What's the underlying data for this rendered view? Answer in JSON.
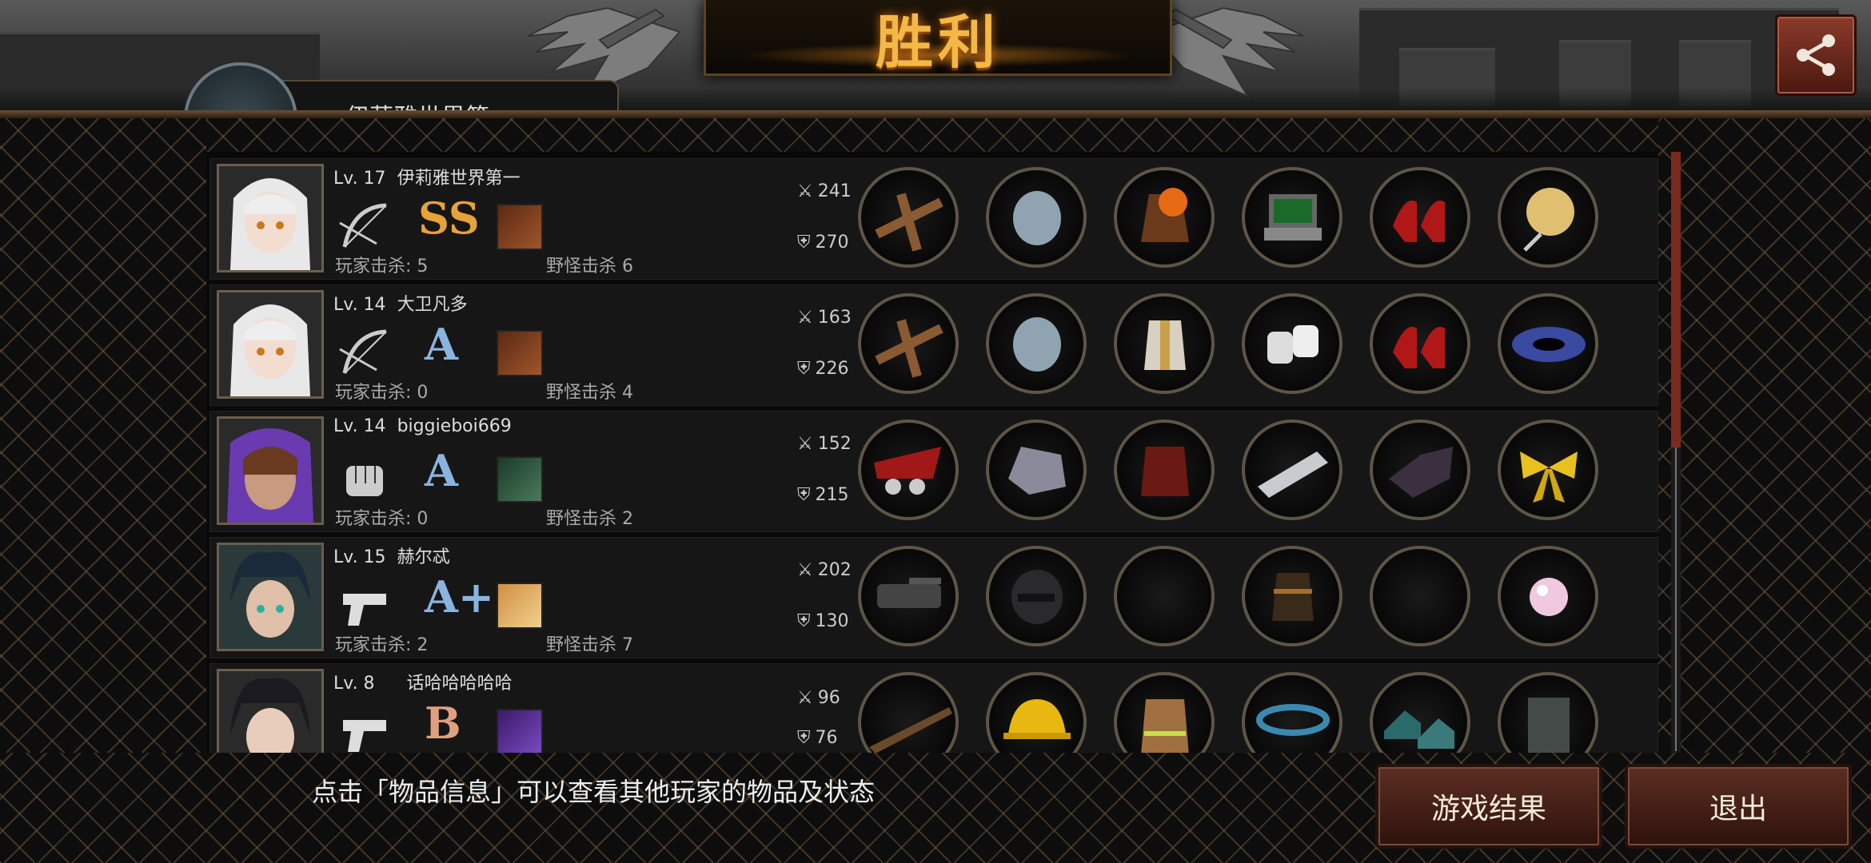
{
  "header": {
    "title": "胜利",
    "player_name_partial": "伊莉雅世界第"
  },
  "share_icon": "share-icon",
  "players": [
    {
      "level": "Lv. 17",
      "name": "伊莉雅世界第一",
      "weapon_icon": "crossbow-bow-icon",
      "rank": "SS",
      "rank_color": "#e8a23a",
      "skill_icon": "skill-icon",
      "player_kills_label": "玩家击杀: 5",
      "monster_kills_label": "野怪击杀 6",
      "attack": "241",
      "defense": "270",
      "items": [
        "crossbow-item",
        "knight-helmet-item",
        "flaming-armor-item",
        "laptop-item",
        "red-heels-item",
        "fan-item"
      ]
    },
    {
      "level": "Lv. 14",
      "name": "大卫凡多",
      "weapon_icon": "crossbow-bow-icon",
      "rank": "A",
      "rank_color": "#8ab4e0",
      "skill_icon": "skill-icon",
      "player_kills_label": "玩家击杀: 0",
      "monster_kills_label": "野怪击杀 4",
      "attack": "163",
      "defense": "226",
      "items": [
        "crossbow-item",
        "knight-helmet-item",
        "white-robe-item",
        "bandage-item",
        "red-heels-item",
        "galaxy-item"
      ]
    },
    {
      "level": "Lv. 14",
      "name": "biggieboi669",
      "weapon_icon": "fist-icon",
      "rank": "A",
      "rank_color": "#8ab4e0",
      "skill_icon": "skill-icon",
      "player_kills_label": "玩家击杀: 0",
      "monster_kills_label": "野怪击杀 2",
      "attack": "152",
      "defense": "215",
      "items": [
        "red-gauntlet-item",
        "mech-helmet-item",
        "red-jacket-item",
        "spiked-bracer-item",
        "dark-gloves-item",
        "gold-ribbon-item"
      ]
    },
    {
      "level": "Lv. 15",
      "name": "赫尔忒",
      "weapon_icon": "pistol-icon",
      "rank": "A+",
      "rank_color": "#8ab4e0",
      "skill_icon": "skill-icon",
      "player_kills_label": "玩家击杀: 2",
      "monster_kills_label": "野怪击杀 7",
      "attack": "202",
      "defense": "130",
      "items": [
        "minigun-item",
        "black-helmet-item",
        "empty-slot",
        "arm-guard-item",
        "empty-slot",
        "pearl-item"
      ]
    },
    {
      "level": "Lv. 8",
      "name": "话哈哈哈哈哈",
      "weapon_icon": "pistol-icon",
      "rank": "B",
      "rank_color": "#e0a080",
      "skill_icon": "skill-icon",
      "player_kills_label": "",
      "monster_kills_label": "",
      "attack": "96",
      "defense": "76",
      "items": [
        "rifle-item",
        "hard-hat-item",
        "firefighter-jacket-item",
        "bead-bracelet-item",
        "sneakers-item",
        "tactical-vest-item"
      ]
    }
  ],
  "footer": {
    "tip": "点击「物品信息」可以查看其他玩家的物品及状态",
    "result_button": "游戏结果",
    "exit_button": "退出"
  }
}
